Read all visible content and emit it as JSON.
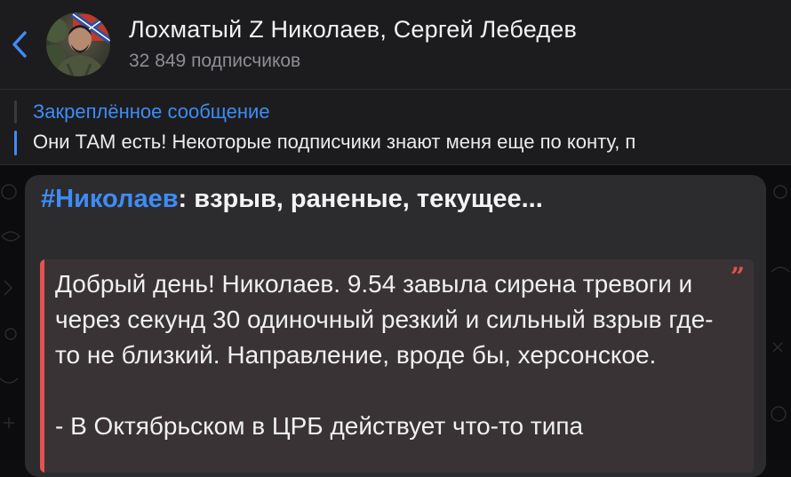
{
  "header": {
    "back_label": "",
    "title": "Лохматый Z Николаев, Сергей Лебедев",
    "subscribers": "32 849 подписчиков"
  },
  "pinned": {
    "label": "Закреплённое сообщение",
    "text": "Они ТАМ есть!  Некоторые подписчики знают меня еще по конту, п"
  },
  "message": {
    "hashtag": "#Николаев",
    "title_rest": ": взрыв, раненые, текущее...",
    "quote_mark": "”",
    "quote_text": "Добрый день!  Николаев.  9.54 завыла сирена тревоги и через секунд 30 одиночный резкий и сильный взрыв где-то не близкий. Направление, вроде бы, херсонское.\n\n- В Октябрьском в ЦРБ действует что-то типа"
  },
  "colors": {
    "accent": "#3e8cf6",
    "quote_accent": "#e5524f",
    "bubble": "#2c2c2e",
    "quote_bg": "#3a3335"
  },
  "icons": {
    "back": "chevron-left-icon",
    "avatar": "channel-avatar"
  }
}
